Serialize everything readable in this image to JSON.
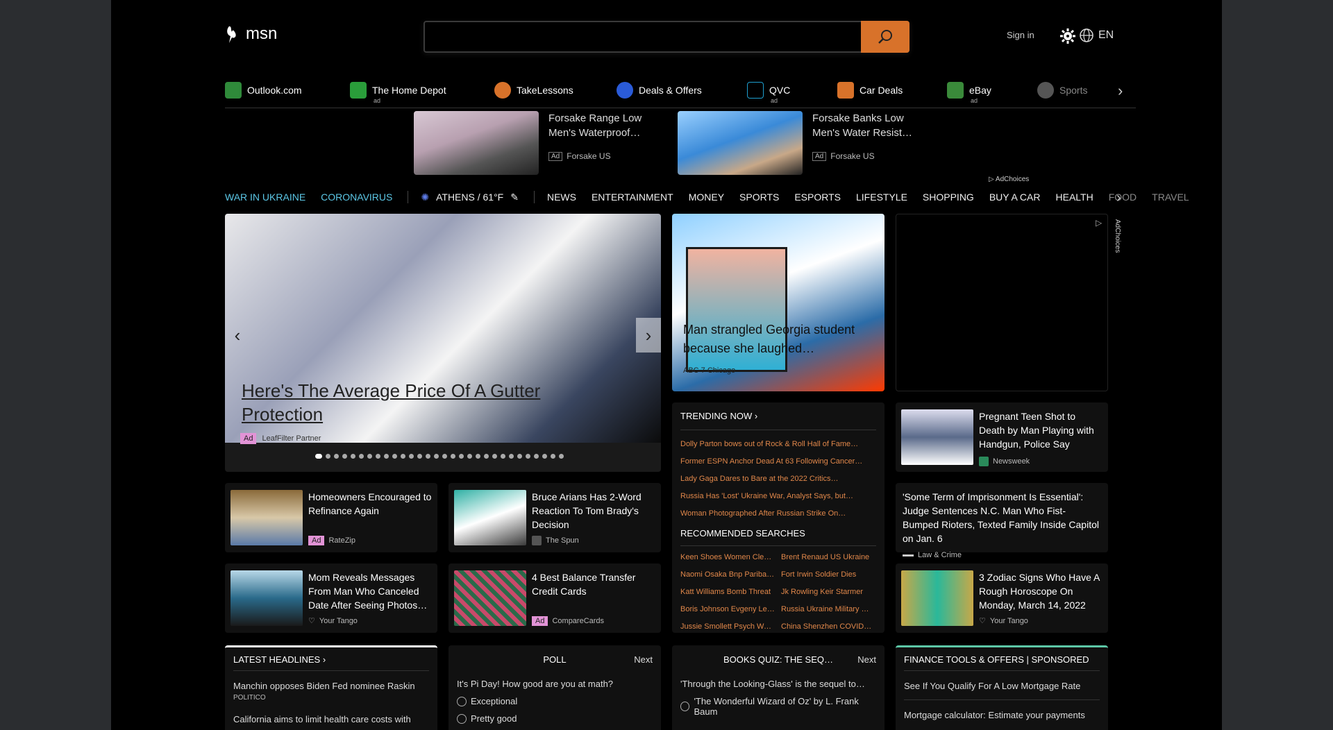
{
  "header": {
    "logo_text": "msn",
    "search_placeholder": "",
    "signin": "Sign in",
    "language": "EN"
  },
  "quicklinks": [
    {
      "label": "Outlook.com",
      "ad": "",
      "color": "#2f8a3a"
    },
    {
      "label": "The Home Depot",
      "ad": "ad",
      "color": "#2a9d3a"
    },
    {
      "label": "TakeLessons",
      "ad": "",
      "color": "#d8722a"
    },
    {
      "label": "Deals & Offers",
      "ad": "",
      "color": "#2a5bd8"
    },
    {
      "label": "QVC",
      "ad": "ad",
      "color": "#1e6f8f"
    },
    {
      "label": "Car Deals",
      "ad": "",
      "color": "#d8722a"
    },
    {
      "label": "eBay",
      "ad": "ad",
      "color": "#3a8a3a"
    },
    {
      "label": "Sports",
      "ad": "",
      "color": "#666666"
    }
  ],
  "top_ads": [
    {
      "title": "Forsake Range Low Men's Waterproof…",
      "badge": "Ad",
      "source": "Forsake US"
    },
    {
      "title": "Forsake Banks Low Men's Water Resist…",
      "badge": "Ad",
      "source": "Forsake US"
    }
  ],
  "adchoices": "AdChoices",
  "nav": {
    "highlights": [
      "WAR IN UKRAINE",
      "CORONAVIRUS"
    ],
    "weather": "ATHENS / 61°F",
    "items": [
      "NEWS",
      "ENTERTAINMENT",
      "MONEY",
      "SPORTS",
      "ESPORTS",
      "LIFESTYLE",
      "SHOPPING",
      "BUY A CAR",
      "HEALTH",
      "FOOD",
      "TRAVEL"
    ]
  },
  "hero": {
    "title": "Here's The Average Price Of A Gutter Protection",
    "badge": "Ad",
    "source": "LeafFilter Partner",
    "dots": 30
  },
  "story2": {
    "title": "Man strangled Georgia student because she laughed…",
    "source": "ABC 7 Chicago"
  },
  "trending": {
    "heading": "TRENDING NOW ›",
    "items": [
      "Dolly Parton bows out of Rock & Roll Hall of Fame…",
      "Former ESPN Anchor Dead At 63 Following Cancer…",
      "Lady Gaga Dares to Bare at the 2022 Critics…",
      "Russia Has 'Lost' Ukraine War, Analyst Says, but…",
      "Woman Photographed After Russian Strike On…"
    ],
    "rec_heading": "RECOMMENDED SEARCHES",
    "rec_items": [
      "Keen Shoes Women Clea…",
      "Brent Renaud US Ukraine",
      "Naomi Osaka Bnp Pariba…",
      "Fort Irwin Soldier Dies",
      "Katt Williams Bomb Threat",
      "Jk Rowling Keir Starmer",
      "Boris Johnson Evgeny Le…",
      "Russia Ukraine Military …",
      "Jussie Smollett Psych Wa…",
      "China Shenzhen COVID…"
    ]
  },
  "cards": {
    "refi": {
      "title": "Homeowners Encouraged to Refinance Again",
      "badge": "Ad",
      "source": "RateZip"
    },
    "arians": {
      "title": "Bruce Arians Has 2-Word Reaction To Tom Brady's Decision",
      "source": "The Spun"
    },
    "mom": {
      "title": "Mom Reveals Messages From Man Who Canceled Date After Seeing Photos…",
      "source": "Your Tango"
    },
    "balance": {
      "title": "4 Best Balance Transfer Credit Cards",
      "badge": "Ad",
      "source": "CompareCards"
    },
    "teen": {
      "title": "Pregnant Teen Shot to Death by Man Playing with Handgun, Police Say",
      "source": "Newsweek"
    },
    "judge": {
      "title": "'Some Term of Imprisonment Is Essential': Judge Sentences N.C. Man Who Fist-Bumped Rioters, Texted Family Inside Capitol on Jan. 6",
      "source": "Law & Crime"
    },
    "zodiac": {
      "title": "3 Zodiac Signs Who Have A Rough Horoscope On Monday, March 14, 2022",
      "source": "Your Tango"
    }
  },
  "bottom": {
    "latest": {
      "heading": "LATEST HEADLINES ›",
      "item1": "Manchin opposes Biden Fed nominee Raskin",
      "src1": "POLITICO",
      "item2": "California aims to limit health care costs with"
    },
    "poll": {
      "heading": "POLL",
      "next": "Next",
      "question": "It's Pi Day! How good are you at math?",
      "opt1": "Exceptional",
      "opt2": "Pretty good"
    },
    "quiz": {
      "heading": "BOOKS QUIZ: THE SEQ…",
      "next": "Next",
      "question": "'Through the Looking-Glass' is the sequel to…",
      "opt1": "'The Wonderful Wizard of Oz' by L. Frank Baum"
    },
    "finance": {
      "heading": "FINANCE TOOLS & OFFERS | SPONSORED",
      "item1": "See If You Qualify For A Low Mortgage Rate",
      "item2": "Mortgage calculator: Estimate your payments"
    }
  }
}
